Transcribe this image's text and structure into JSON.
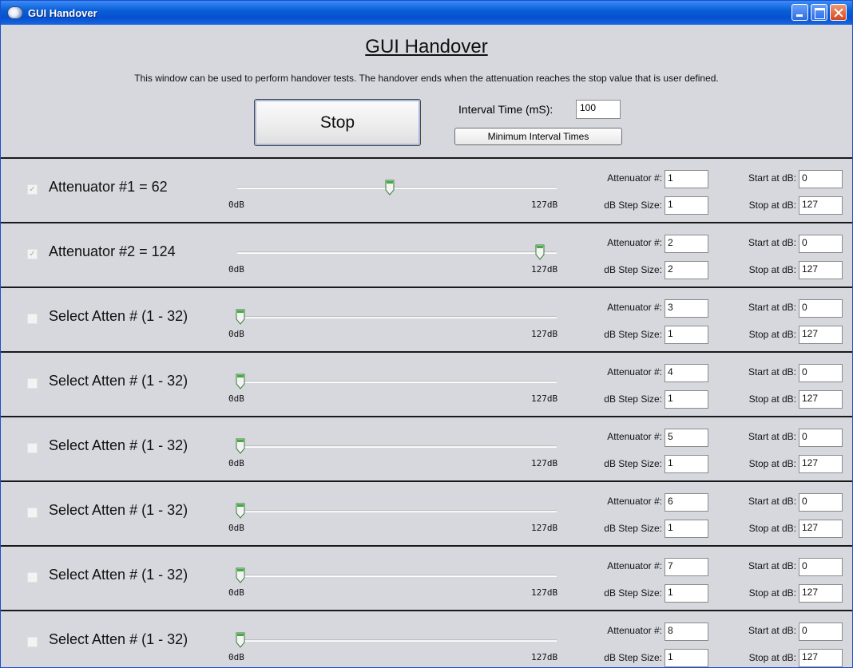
{
  "window": {
    "title": "GUI Handover"
  },
  "header": {
    "heading": "GUI Handover",
    "description": "This window can be used to perform handover tests.  The handover ends when the attenuation reaches the stop value that is user defined.",
    "stop_label": "Stop",
    "interval_label": "Interval Time (mS):",
    "interval_value": "100",
    "min_interval_label": "Minimum Interval Times"
  },
  "slider": {
    "min": 0,
    "max": 127,
    "min_label": "0dB",
    "max_label": "127dB"
  },
  "field_labels": {
    "attenuator": "Attenuator #:",
    "step": "dB Step Size:",
    "start": "Start at dB:",
    "stop": "Stop at dB:"
  },
  "rows": [
    {
      "checked": true,
      "label": "Attenuator #1 = 62",
      "value": 62,
      "attenuator": "1",
      "step": "1",
      "start": "0",
      "stop": "127"
    },
    {
      "checked": true,
      "label": "Attenuator #2 = 124",
      "value": 124,
      "attenuator": "2",
      "step": "2",
      "start": "0",
      "stop": "127"
    },
    {
      "checked": false,
      "label": "Select Atten # (1 - 32)",
      "value": 0,
      "attenuator": "3",
      "step": "1",
      "start": "0",
      "stop": "127"
    },
    {
      "checked": false,
      "label": "Select Atten # (1 - 32)",
      "value": 0,
      "attenuator": "4",
      "step": "1",
      "start": "0",
      "stop": "127"
    },
    {
      "checked": false,
      "label": "Select Atten # (1 - 32)",
      "value": 0,
      "attenuator": "5",
      "step": "1",
      "start": "0",
      "stop": "127"
    },
    {
      "checked": false,
      "label": "Select Atten # (1 - 32)",
      "value": 0,
      "attenuator": "6",
      "step": "1",
      "start": "0",
      "stop": "127"
    },
    {
      "checked": false,
      "label": "Select Atten # (1 - 32)",
      "value": 0,
      "attenuator": "7",
      "step": "1",
      "start": "0",
      "stop": "127"
    },
    {
      "checked": false,
      "label": "Select Atten # (1 - 32)",
      "value": 0,
      "attenuator": "8",
      "step": "1",
      "start": "0",
      "stop": "127"
    }
  ]
}
